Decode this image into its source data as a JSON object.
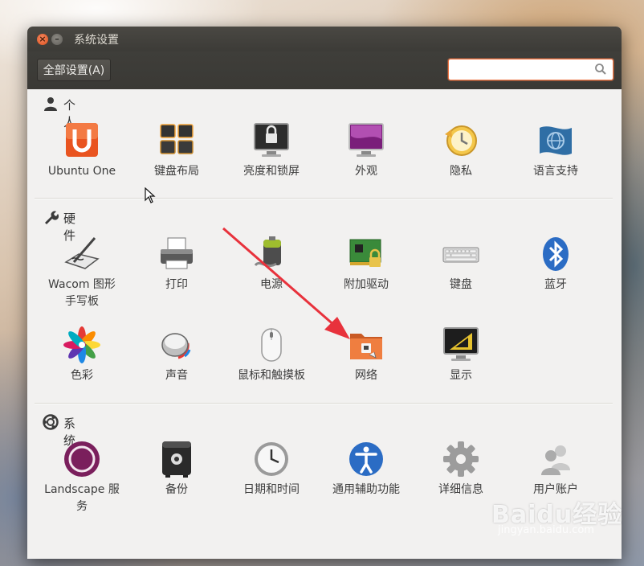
{
  "window": {
    "title": "系统设置"
  },
  "toolbar": {
    "all_settings": "全部设置(A)",
    "search_value": ""
  },
  "sections": {
    "personal": {
      "title": "个人",
      "items": [
        {
          "label": "Ubuntu One",
          "icon": "ubuntu-one-icon"
        },
        {
          "label": "键盘布局",
          "icon": "keyboard-layout-icon"
        },
        {
          "label": "亮度和锁屏",
          "icon": "brightness-lock-icon"
        },
        {
          "label": "外观",
          "icon": "appearance-icon"
        },
        {
          "label": "隐私",
          "icon": "privacy-icon"
        },
        {
          "label": "语言支持",
          "icon": "language-support-icon"
        }
      ]
    },
    "hardware": {
      "title": "硬件",
      "items": [
        {
          "label": "Wacom 图形\n手写板",
          "icon": "wacom-tablet-icon"
        },
        {
          "label": "打印",
          "icon": "printer-icon"
        },
        {
          "label": "电源",
          "icon": "power-icon"
        },
        {
          "label": "附加驱动",
          "icon": "additional-drivers-icon"
        },
        {
          "label": "键盘",
          "icon": "keyboard-icon"
        },
        {
          "label": "蓝牙",
          "icon": "bluetooth-icon"
        },
        {
          "label": "色彩",
          "icon": "color-icon"
        },
        {
          "label": "声音",
          "icon": "sound-icon"
        },
        {
          "label": "鼠标和触摸板",
          "icon": "mouse-touchpad-icon"
        },
        {
          "label": "网络",
          "icon": "network-icon"
        },
        {
          "label": "显示",
          "icon": "display-icon"
        }
      ]
    },
    "system": {
      "title": "系统",
      "items": [
        {
          "label": "Landscape 服\n务",
          "icon": "landscape-icon"
        },
        {
          "label": "备份",
          "icon": "backup-icon"
        },
        {
          "label": "日期和时间",
          "icon": "clock-icon"
        },
        {
          "label": "通用辅助功能",
          "icon": "accessibility-icon"
        },
        {
          "label": "详细信息",
          "icon": "details-gear-icon"
        },
        {
          "label": "用户账户",
          "icon": "user-accounts-icon"
        }
      ]
    }
  },
  "watermark": {
    "logo_text": "Baidu经验",
    "url": "jingyan.baidu.com"
  },
  "colors": {
    "accent": "#f07746",
    "titlebar": "#3c3b37",
    "annotation_arrow": "#e8323c"
  }
}
